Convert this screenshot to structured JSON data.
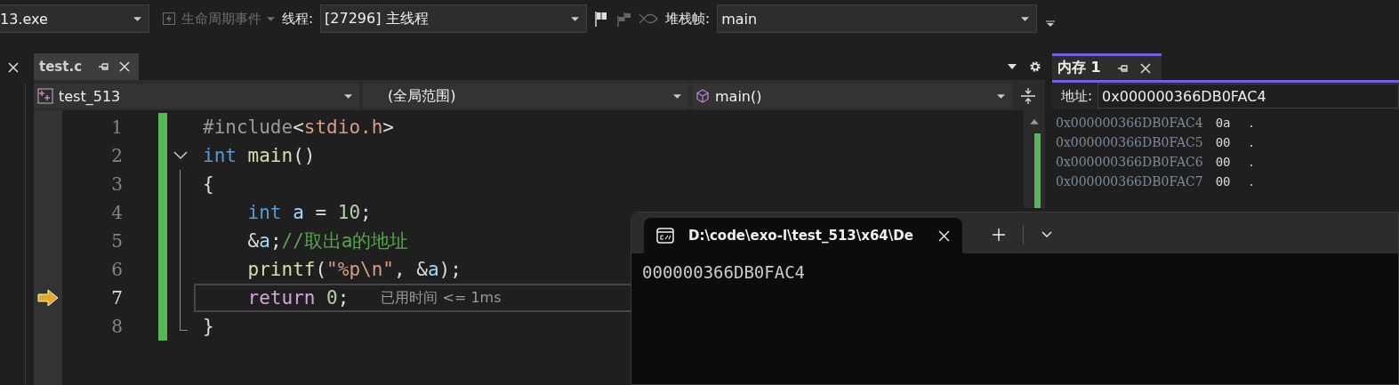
{
  "toolbar": {
    "process": "13.exe",
    "lifecycle": {
      "label": "生命周期事件",
      "disabled": true
    },
    "thread_label": "线程:",
    "thread": "[27296] 主线程",
    "stack_label": "堆栈帧:",
    "stack": "main"
  },
  "editor": {
    "tabs": [
      {
        "label": "test.c",
        "selected": true
      }
    ],
    "nav": {
      "project": "test_513",
      "scope": "(全局范围)",
      "function": "main()"
    },
    "lines": [
      {
        "number": "1",
        "current": false,
        "fold_start": false,
        "tokens": [
          {
            "kind": "preproc",
            "text": "#include"
          },
          {
            "kind": "plain",
            "text": "<"
          },
          {
            "kind": "string",
            "text": "stdio.h"
          },
          {
            "kind": "plain",
            "text": ">"
          }
        ]
      },
      {
        "number": "2",
        "current": false,
        "fold_start": true,
        "tokens": [
          {
            "kind": "keyword",
            "text": "int"
          },
          {
            "kind": "func",
            "text": " main"
          },
          {
            "kind": "plain",
            "text": "()"
          }
        ]
      },
      {
        "number": "3",
        "current": false,
        "fold_start": false,
        "tokens": [
          {
            "kind": "plain",
            "text": "{"
          }
        ]
      },
      {
        "number": "4",
        "current": false,
        "fold_start": false,
        "tokens": [
          {
            "kind": "keyword",
            "text": "    int"
          },
          {
            "kind": "var",
            "text": " a"
          },
          {
            "kind": "plain",
            "text": " = "
          },
          {
            "kind": "number",
            "text": "10"
          },
          {
            "kind": "plain",
            "text": ";"
          }
        ]
      },
      {
        "number": "5",
        "current": false,
        "fold_start": false,
        "tokens": [
          {
            "kind": "plain",
            "text": "    &"
          },
          {
            "kind": "var",
            "text": "a"
          },
          {
            "kind": "plain",
            "text": ";"
          },
          {
            "kind": "comment",
            "text": "//取出a的地址"
          }
        ]
      },
      {
        "number": "6",
        "current": false,
        "fold_start": false,
        "tokens": [
          {
            "kind": "func",
            "text": "    printf"
          },
          {
            "kind": "plain",
            "text": "("
          },
          {
            "kind": "string",
            "text": "\"%p\\n\""
          },
          {
            "kind": "plain",
            "text": ", &"
          },
          {
            "kind": "var",
            "text": "a"
          },
          {
            "kind": "plain",
            "text": ");"
          }
        ]
      },
      {
        "number": "7",
        "current": true,
        "fold_start": false,
        "hint": "已用时间 <= 1ms",
        "tokens": [
          {
            "kind": "control",
            "text": "    return"
          },
          {
            "kind": "number",
            "text": " 0"
          },
          {
            "kind": "plain",
            "text": ";"
          }
        ]
      },
      {
        "number": "8",
        "current": false,
        "fold_start": false,
        "tokens": [
          {
            "kind": "plain",
            "text": "}"
          }
        ]
      }
    ]
  },
  "memory": {
    "tab": {
      "label": "内存 1",
      "selected": true
    },
    "address_label": "地址:",
    "address": "0x000000366DB0FAC4",
    "rows": [
      {
        "address": "0x000000366DB0FAC4",
        "value": "0a",
        "char": "."
      },
      {
        "address": "0x000000366DB0FAC5",
        "value": "00",
        "char": "."
      },
      {
        "address": "0x000000366DB0FAC6",
        "value": "00",
        "char": "."
      },
      {
        "address": "0x000000366DB0FAC7",
        "value": "00",
        "char": "."
      }
    ]
  },
  "terminal": {
    "tab": {
      "title": "D:\\code\\exo-l\\test_513\\x64\\De",
      "selected": true
    },
    "output": "000000366DB0FAC4"
  }
}
